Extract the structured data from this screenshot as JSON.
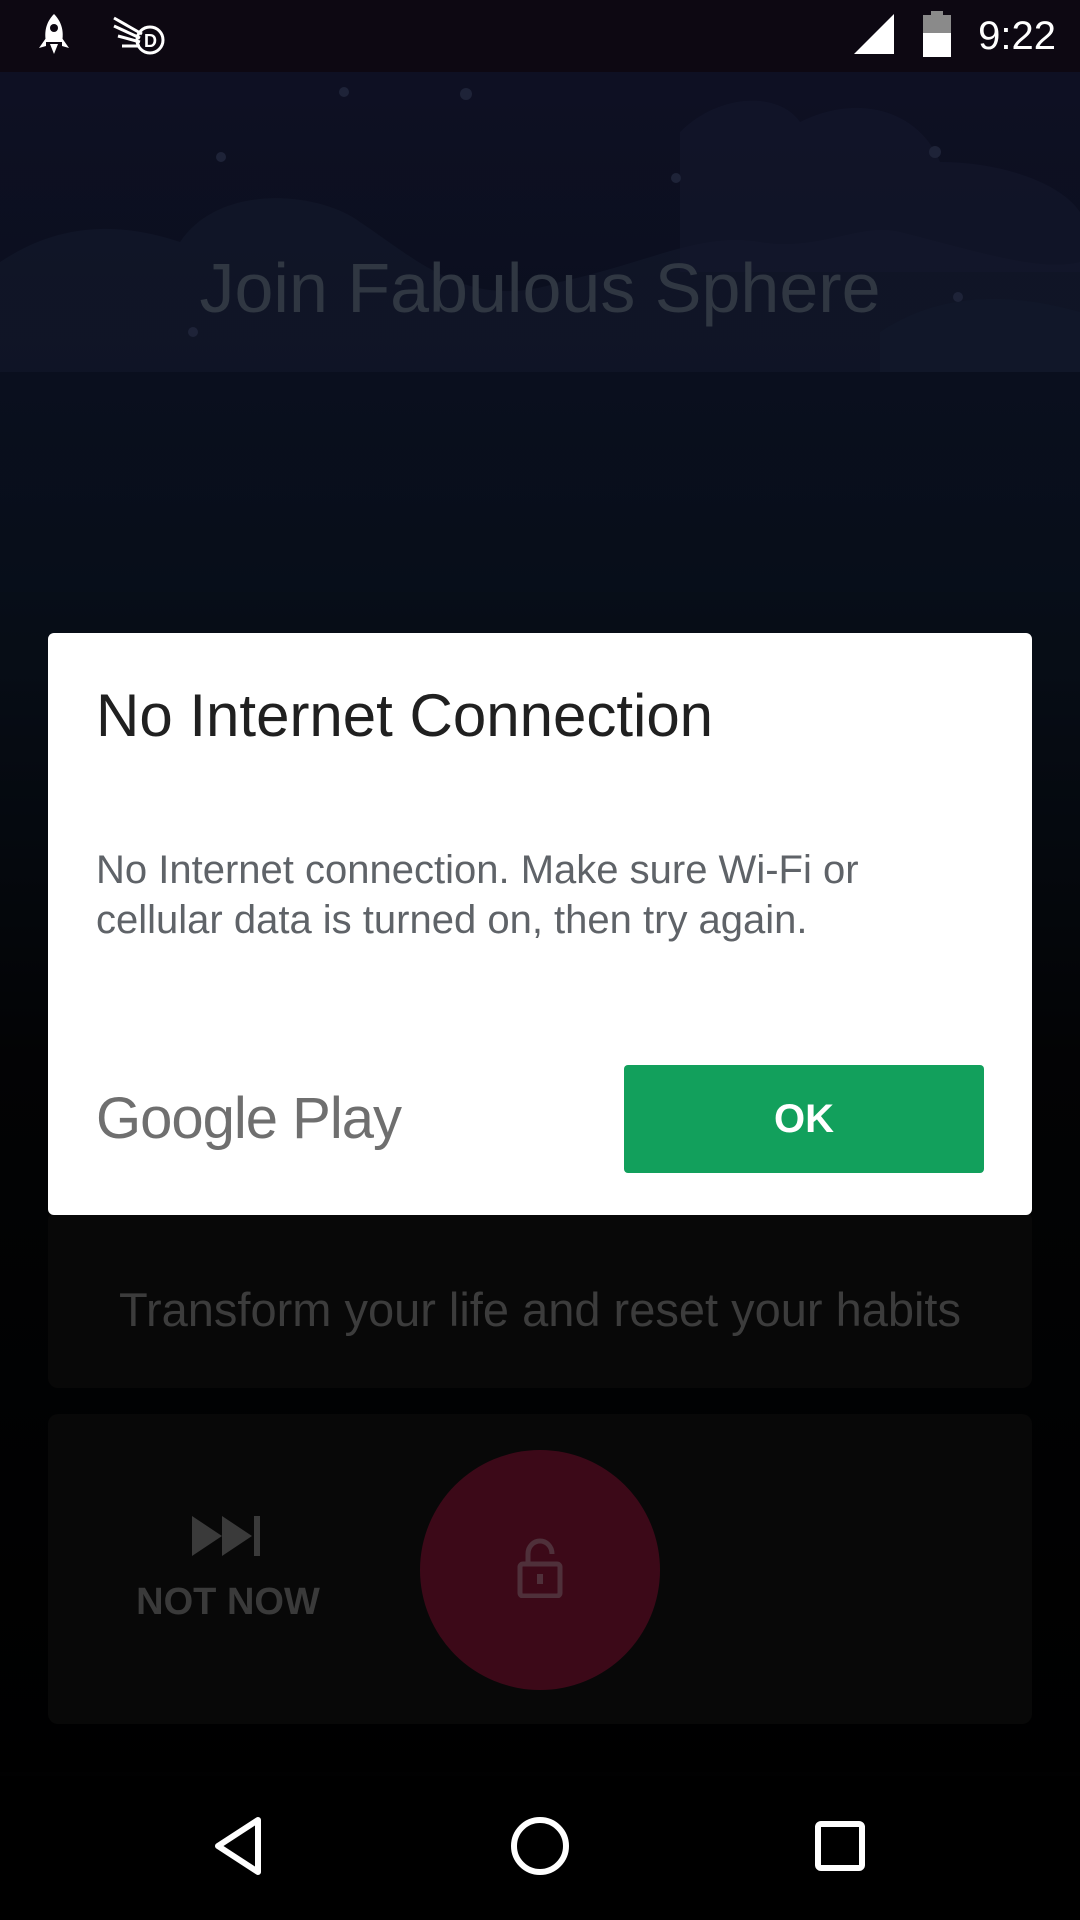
{
  "status_bar": {
    "time": "9:22",
    "left_icons": [
      "rocket-icon",
      "dash-app-icon"
    ],
    "right_icons": [
      "signal-icon",
      "battery-icon"
    ]
  },
  "background": {
    "title": "Join Fabulous Sphere",
    "habit_text": "Transform your life and reset your habits",
    "not_now_label": "NOT NOW",
    "unlock_color": "#5c0f26"
  },
  "dialog": {
    "title": "No Internet Connection",
    "message": "No Internet connection. Make sure Wi-Fi or cellular data is turned on, then try again.",
    "brand": "Google Play",
    "ok_label": "OK",
    "ok_color": "#12a05c"
  },
  "nav_bar": {
    "buttons": [
      "back-icon",
      "home-icon",
      "recents-icon"
    ]
  }
}
